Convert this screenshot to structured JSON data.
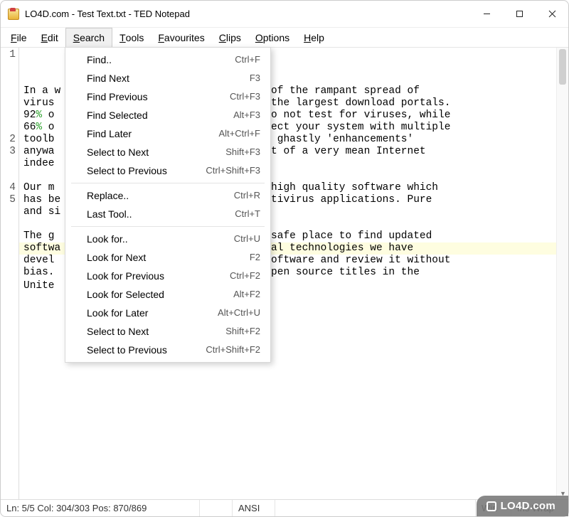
{
  "window": {
    "title": "LO4D.com - Test Text.txt - TED Notepad"
  },
  "menubar": [
    "File",
    "Edit",
    "Search",
    "Tools",
    "Favourites",
    "Clips",
    "Options",
    "Help"
  ],
  "active_menu_index": 2,
  "dropdown": {
    "groups": [
      [
        {
          "label": "Find..",
          "accel": "Ctrl+F"
        },
        {
          "label": "Find Next",
          "accel": "F3"
        },
        {
          "label": "Find Previous",
          "accel": "Ctrl+F3"
        },
        {
          "label": "Find Selected",
          "accel": "Alt+F3"
        },
        {
          "label": "Find Later",
          "accel": "Alt+Ctrl+F"
        },
        {
          "label": "Select to Next",
          "accel": "Shift+F3"
        },
        {
          "label": "Select to Previous",
          "accel": "Ctrl+Shift+F3"
        }
      ],
      [
        {
          "label": "Replace..",
          "accel": "Ctrl+R"
        },
        {
          "label": "Last Tool..",
          "accel": "Ctrl+T"
        }
      ],
      [
        {
          "label": "Look for..",
          "accel": "Ctrl+U"
        },
        {
          "label": "Look for Next",
          "accel": "F2"
        },
        {
          "label": "Look for Previous",
          "accel": "Ctrl+F2"
        },
        {
          "label": "Look for Selected",
          "accel": "Alt+F2"
        },
        {
          "label": "Look for Later",
          "accel": "Alt+Ctrl+U"
        },
        {
          "label": "Select to Next",
          "accel": "Shift+F2"
        },
        {
          "label": "Select to Previous",
          "accel": "Ctrl+Shift+F2"
        }
      ]
    ]
  },
  "editor": {
    "gutter": [
      "1",
      "2",
      "3",
      "4",
      "5"
    ],
    "lines": [
      {
        "segments": [
          {
            "t": "In a w"
          },
          {
            "t": "",
            "hidden": true
          },
          {
            "t": "use of the rampant spread of virus"
          },
          {
            "t": " on the largest download portals. 92"
          },
          {
            "t": "%",
            "cls": "pct"
          },
          {
            "t": " o"
          },
          {
            "t": "es do not test for viruses, while 66"
          },
          {
            "t": "%",
            "cls": "pct"
          },
          {
            "t": " o"
          },
          {
            "t": " infect your system with multiple toolb"
          },
          {
            "t": "ther ghastly 'enhancements' anywa"
          },
          {
            "t": "esert of a very mean Internet indee"
          }
        ]
      },
      {
        "segments": [
          {
            "t": ""
          }
        ]
      },
      {
        "segments": [
          {
            "t": "Our m"
          },
          {
            "t": "ith high quality software which has be"
          },
          {
            "t": "t antivirus applications. Pure and si"
          }
        ]
      },
      {
        "segments": [
          {
            "t": ""
          }
        ]
      },
      {
        "segments": [
          {
            "t": "The g"
          },
          {
            "t": "e a safe place to find updated softwa"
          },
          {
            "t": "everal technologies we have devel"
          },
          {
            "t": "ty software and review it without bias."
          },
          {
            "t": "nd open source titles in the Unite"
          },
          {
            "t": "a."
          }
        ]
      }
    ],
    "raw_par1": "In a w                              use of the rampant spread of\nvirus                                on the largest download portals.\n92% o                               es do not test for viruses, while\n66% o                                infect your system with multiple\ntoolb                               ther ghastly 'enhancements'\nanywa                               esert of a very mean Internet\nindee",
    "raw_par3": "Our m                               ith high quality software which\nhas be                              t antivirus applications. Pure\nand si",
    "raw_par5": "The g                               e a safe place to find updated\nsoftwa                              everal technologies we have\ndevel                               ty software and review it without\nbias.                               nd open source titles in the\nUnite                               a."
  },
  "statusbar": {
    "pos": "Ln: 5/5  Col: 304/303  Pos: 870/869",
    "encoding": "ANSI",
    "os": "Win",
    "mode1": "Ins",
    "mode2": "Wrap"
  },
  "watermark": "LO4D.com"
}
